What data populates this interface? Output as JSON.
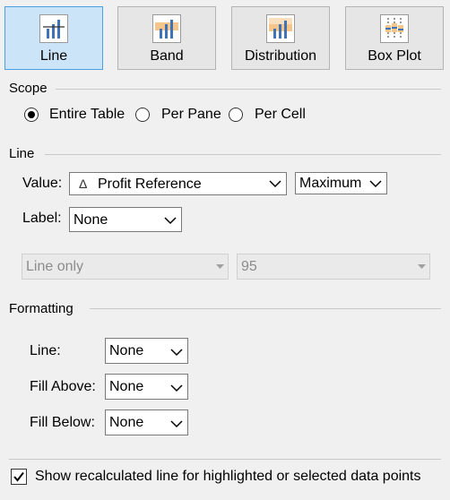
{
  "type_tabs": [
    {
      "label": "Line",
      "icon": "line-chart-icon",
      "selected": true
    },
    {
      "label": "Band",
      "icon": "band-chart-icon",
      "selected": false
    },
    {
      "label": "Distribution",
      "icon": "distribution-chart-icon",
      "selected": false
    },
    {
      "label": "Box Plot",
      "icon": "box-plot-icon",
      "selected": false
    }
  ],
  "scope": {
    "title": "Scope",
    "options": [
      {
        "label": "Entire Table",
        "checked": true
      },
      {
        "label": "Per Pane",
        "checked": false
      },
      {
        "label": "Per Cell",
        "checked": false
      }
    ]
  },
  "line": {
    "title": "Line",
    "value_label": "Value:",
    "value_field_icon": "delta-icon",
    "value_field_icon_glyph": "Δ",
    "value_field": "Profit Reference",
    "aggregation": "Maximum",
    "label_label": "Label:",
    "label_value": "None",
    "line_type": "Line only",
    "percentile": "95"
  },
  "formatting": {
    "title": "Formatting",
    "line_label": "Line:",
    "line_value": "None",
    "fill_above_label": "Fill Above:",
    "fill_above_value": "None",
    "fill_below_label": "Fill Below:",
    "fill_below_value": "None"
  },
  "recalc": {
    "label": "Show recalculated line for highlighted or selected data points",
    "checked": true
  },
  "colors": {
    "selected_tab_bg": "#cce4f7",
    "selected_tab_border": "#4aa0e0",
    "bar_blue": "#3f72b6",
    "band_orange": "#f6c58a"
  }
}
